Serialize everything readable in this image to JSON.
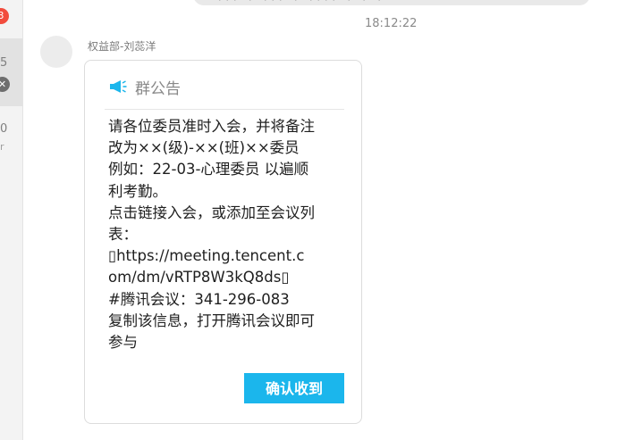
{
  "sidebar": {
    "badge_count": "3",
    "item_count_1": "5",
    "item_count_2": "0",
    "fragment": "r"
  },
  "chat": {
    "timestamp": "18:12:22",
    "sender": "权益部-刘蕊洋"
  },
  "announcement": {
    "title": "群公告",
    "lines": [
      "请各位委员准时入会，并将备注",
      "改为××(级)-××(班)××委员",
      "例如：22-03-心理委员 以遍顺",
      "利考勤。",
      "点击链接入会，或添加至会议列",
      "表：",
      "https://meeting.tencent.c",
      "om/dm/vRTP8W3kQ8ds",
      "#腾讯会议：341-296-083",
      "复制该信息，打开腾讯会议即可",
      "参与"
    ],
    "confirm_label": "确认收到",
    "accent_color": "#1bb6ec"
  }
}
